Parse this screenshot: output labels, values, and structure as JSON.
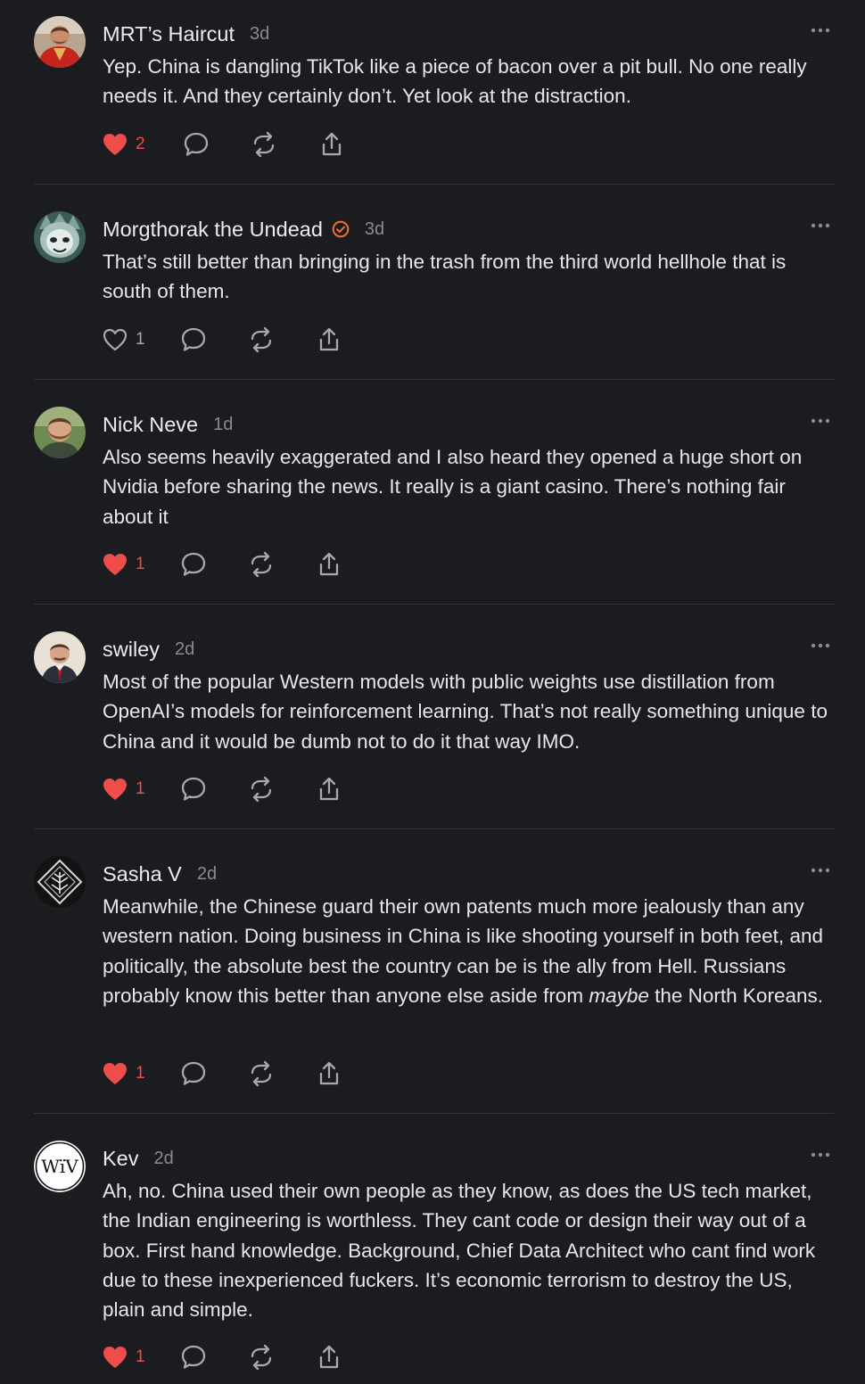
{
  "colors": {
    "background": "#1b1c1f",
    "like_active": "#ef4c4c",
    "verified_badge": "#f0722c",
    "muted_text": "#8a8b8f"
  },
  "comments": [
    {
      "author": "MRT’s Haircut",
      "time": "3d",
      "verified": false,
      "avatar_icon": "avatar-red-shirt-man",
      "text_html": "Yep. China is dangling TikTok like a piece of bacon over a pit bull. No one really needs it. And they certainly don’t. Yet look at the distraction.",
      "likes": "2",
      "liked": true
    },
    {
      "author": "Morgthorak the Undead",
      "time": "3d",
      "verified": true,
      "avatar_icon": "avatar-armored-mask",
      "text_html": "That’s still better than bringing in the trash from the third world hellhole that is south of them.",
      "likes": "1",
      "liked": false
    },
    {
      "author": "Nick Neve",
      "time": "1d",
      "verified": false,
      "avatar_icon": "avatar-bearded-man",
      "text_html": "Also seems heavily exaggerated and I also heard they opened a huge short on Nvidia before sharing the news. It really is a giant casino. There’s nothing fair about it",
      "likes": "1",
      "liked": true
    },
    {
      "author": "swiley",
      "time": "2d",
      "verified": false,
      "avatar_icon": "avatar-suited-man",
      "text_html": "Most of the popular Western models with public weights use distillation from OpenAI’s models for reinforcement learning. That’s not really something unique to China and it would be dumb not to do it that way IMO.",
      "likes": "1",
      "liked": true
    },
    {
      "author": "Sasha V",
      "time": "2d",
      "verified": false,
      "avatar_icon": "avatar-diamond-emblem",
      "text_html": "Meanwhile, the Chinese guard their own patents much more jealously than any western nation. Doing business in China is like shooting yourself in both feet, and politically, the absolute best the country can be is the ally from Hell. Russians probably know this better than anyone else aside from <em>maybe</em> the North Koreans.",
      "likes": "1",
      "liked": true
    },
    {
      "author": "Kev",
      "time": "2d",
      "verified": false,
      "avatar_icon": "avatar-wiv-logo",
      "avatar_text": "WïV",
      "text_html": "Ah, no. China used their own people as they know, as does the US tech market, the Indian engineering is worthless. They cant code or design their way out of a box. First hand knowledge. Background, Chief Data Architect who cant find work due to these inexperienced fuckers. It’s economic terrorism to destroy the US, plain and simple.",
      "likes": "1",
      "liked": true
    }
  ]
}
